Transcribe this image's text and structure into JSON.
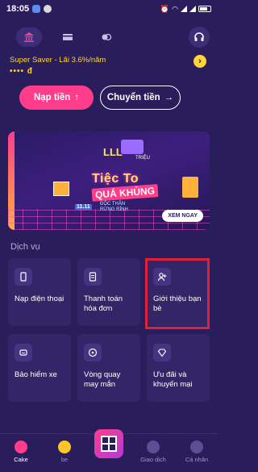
{
  "status_bar": {
    "time": "18:05"
  },
  "account": {
    "product_label": "Super Saver - Lãi 3.6%/năm",
    "balance": "•••• đ"
  },
  "actions": {
    "topup_label": "Nạp tiền",
    "transfer_label": "Chuyển tiền"
  },
  "banner": {
    "badge": "LLL",
    "badge_caption": "TRIỆU",
    "headline": "Tiệc To",
    "subheadline": "QUÁ KHỦNG",
    "tagline_1": "ĐỘC THÂN",
    "tagline_2": "RỪNG RỈNH",
    "date": "11.11",
    "cta": "XEM NGAY"
  },
  "services_title": "Dịch vụ",
  "services": [
    {
      "label": "Nạp điện thoại",
      "icon": "phone-icon"
    },
    {
      "label": "Thanh toán hóa đơn",
      "icon": "bill-icon"
    },
    {
      "label": "Giới thiệu bạn bè",
      "icon": "add-user-icon"
    },
    {
      "label": "Bảo hiểm xe",
      "icon": "car-icon"
    },
    {
      "label": "Vòng quay may mắn",
      "icon": "wheel-icon"
    },
    {
      "label": "Ưu đãi và khuyến mại",
      "icon": "diamond-icon"
    }
  ],
  "bottom_nav": {
    "cake": "Cake",
    "be": "be",
    "transactions": "Giao dịch",
    "profile": "Cá nhân"
  },
  "colors": {
    "background": "#2a1d5c",
    "accent_pink": "#ff3d8b",
    "accent_yellow": "#ffd43b",
    "highlight_red": "#e1213a"
  }
}
